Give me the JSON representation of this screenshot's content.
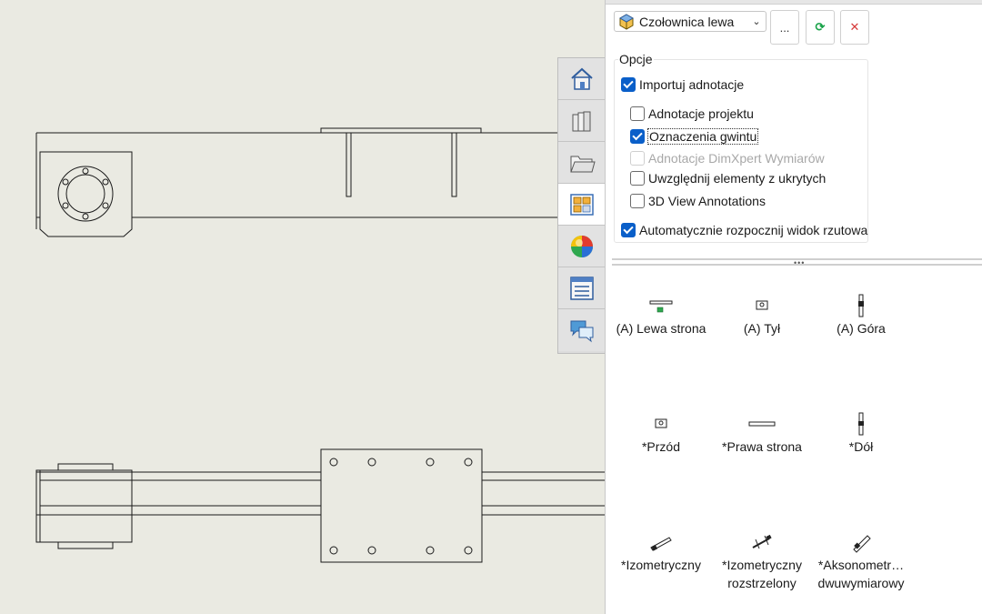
{
  "panel": {
    "model_select": {
      "value": "Czołownica lewa",
      "icon": "part-cube-icon"
    },
    "browse_label": "...",
    "refresh_icon": "refresh-icon",
    "close_icon": "close-icon",
    "options": {
      "title": "Opcje",
      "import_annotations": {
        "label": "Importuj adnotacje",
        "checked": true
      },
      "design_annotations": {
        "label": "Adnotacje projektu",
        "checked": false
      },
      "thread_marks": {
        "label": "Oznaczenia gwintu",
        "checked": true
      },
      "dimxpert": {
        "label": "Adnotacje DimXpert Wymiarów",
        "checked": false,
        "disabled": true
      },
      "hidden_items": {
        "label": "Uwzględnij elementy z ukrytych",
        "checked": false
      },
      "view3d": {
        "label": "3D View Annotations",
        "checked": false
      },
      "auto_projection": {
        "label": "Automatycznie rozpocznij widok rzutowa",
        "checked": true
      }
    },
    "views": [
      {
        "label": "(A) Lewa strona"
      },
      {
        "label": "(A) Tył"
      },
      {
        "label": "(A) Góra"
      },
      {
        "label": "*Przód"
      },
      {
        "label": "*Prawa strona"
      },
      {
        "label": "*Dół"
      },
      {
        "label": "*Izometryczny"
      },
      {
        "label": "*Izometryczny\nrozstrzelony"
      },
      {
        "label": "*Aksonometr…\ndwuwymiarowy"
      }
    ]
  },
  "tabs": [
    {
      "icon": "home-icon"
    },
    {
      "icon": "design-library-icon"
    },
    {
      "icon": "folder-icon"
    },
    {
      "icon": "view-palette-icon",
      "active": true
    },
    {
      "icon": "appearance-icon"
    },
    {
      "icon": "custom-properties-icon"
    },
    {
      "icon": "forum-icon"
    }
  ],
  "colors": {
    "accent": "#0a5fc9",
    "canvas": "#eaeae2",
    "refresh": "#1aa34a",
    "close": "#d63a3a"
  }
}
